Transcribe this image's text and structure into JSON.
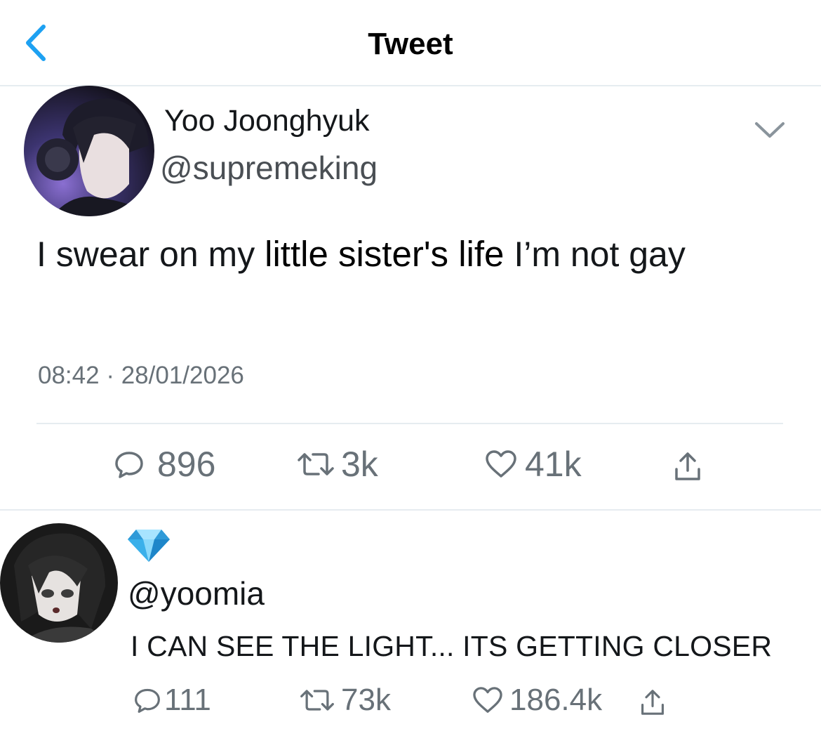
{
  "header": {
    "title": "Tweet",
    "back_icon": "chevron-left-icon",
    "accent_color": "#1da1f2"
  },
  "tweet": {
    "author": {
      "display_name": "Yoo Joonghyuk",
      "handle": "@supremeking"
    },
    "text_segments": [
      "I swear on my ",
      "little sister's life",
      " I’m not gay"
    ],
    "time": "08:42",
    "separator": "·",
    "date": "28/01/2026",
    "stats": {
      "replies": "896",
      "retweets": "3k",
      "likes": "41k"
    }
  },
  "reply": {
    "display_name_emoji": "gem-icon",
    "handle": "@yoomia",
    "text": "I CAN SEE THE LIGHT... ITS GETTING CLOSER",
    "stats": {
      "replies": "111",
      "retweets": "73k",
      "likes": "186.4k"
    }
  },
  "colors": {
    "text_primary": "#14171a",
    "text_secondary": "#687178",
    "divider": "#e6ecf0"
  }
}
